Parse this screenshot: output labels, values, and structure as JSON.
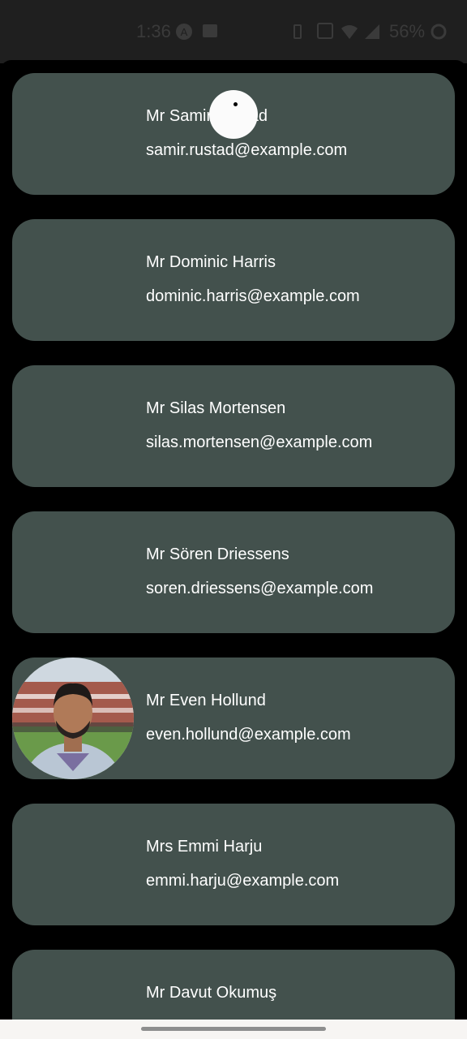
{
  "status_bar": {
    "time": "1:36",
    "battery": "56%",
    "icons": [
      "a-circle-icon",
      "image-icon",
      "vibrate-icon",
      "nfc-icon",
      "wifi-icon",
      "signal-icon",
      "battery-icon"
    ]
  },
  "contacts": [
    {
      "name": "Mr Samir Rustad",
      "email": "samir.rustad@example.com",
      "has_photo": false
    },
    {
      "name": "Mr Dominic Harris",
      "email": "dominic.harris@example.com",
      "has_photo": false
    },
    {
      "name": "Mr Silas Mortensen",
      "email": "silas.mortensen@example.com",
      "has_photo": false
    },
    {
      "name": "Mr Sören Driessens",
      "email": "soren.driessens@example.com",
      "has_photo": false
    },
    {
      "name": "Mr Even Hollund",
      "email": "even.hollund@example.com",
      "has_photo": true
    },
    {
      "name": "Mrs Emmi Harju",
      "email": "emmi.harju@example.com",
      "has_photo": false
    },
    {
      "name": "Mr Davut Okumuş",
      "email": "",
      "has_photo": false
    }
  ],
  "colors": {
    "card_background": "#43514d",
    "page_background": "#000000",
    "text": "#ffffff"
  }
}
